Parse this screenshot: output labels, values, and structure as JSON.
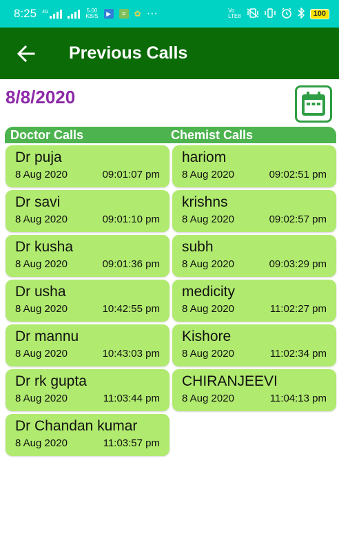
{
  "status_bar": {
    "time": "8:25",
    "net_speed_value": "5.00",
    "net_speed_unit": "KB/S",
    "network_tag": "4G",
    "volte_top": "Vo",
    "volte_bottom": "LTE8",
    "battery": "100",
    "more": "···"
  },
  "app_bar": {
    "title": "Previous Calls",
    "back_icon": "arrow-left-icon"
  },
  "date": "8/8/2020",
  "calendar_icon": "calendar-icon",
  "columns": {
    "doctor_header": "Doctor Calls",
    "chemist_header": "Chemist Calls"
  },
  "doctor_calls": [
    {
      "name": "Dr puja",
      "date": "8 Aug 2020",
      "time": "09:01:07 pm"
    },
    {
      "name": "Dr savi",
      "date": "8 Aug 2020",
      "time": "09:01:10 pm"
    },
    {
      "name": "Dr kusha",
      "date": "8 Aug 2020",
      "time": "09:01:36 pm"
    },
    {
      "name": "Dr usha",
      "date": "8 Aug 2020",
      "time": "10:42:55 pm"
    },
    {
      "name": "Dr mannu",
      "date": "8 Aug 2020",
      "time": "10:43:03 pm"
    },
    {
      "name": "Dr rk gupta",
      "date": "8 Aug 2020",
      "time": "11:03:44 pm"
    },
    {
      "name": "Dr Chandan kumar",
      "date": "8 Aug 2020",
      "time": "11:03:57 pm"
    }
  ],
  "chemist_calls": [
    {
      "name": "hariom",
      "date": "8 Aug 2020",
      "time": "09:02:51 pm"
    },
    {
      "name": "krishns",
      "date": "8 Aug 2020",
      "time": "09:02:57 pm"
    },
    {
      "name": "subh",
      "date": "8 Aug 2020",
      "time": "09:03:29 pm"
    },
    {
      "name": "medicity",
      "date": "8 Aug 2020",
      "time": "11:02:27 pm"
    },
    {
      "name": "Kishore",
      "date": "8 Aug 2020",
      "time": "11:02:34 pm"
    },
    {
      "name": "CHIRANJEEVI",
      "date": "8 Aug 2020",
      "time": "11:04:13 pm"
    }
  ],
  "colors": {
    "status_bar": "#00d3c4",
    "app_bar": "#0b6b06",
    "date_text": "#8c2aa8",
    "header_bar": "#4db34f",
    "card": "#b0ea6e",
    "calendar": "#2f9e44"
  }
}
